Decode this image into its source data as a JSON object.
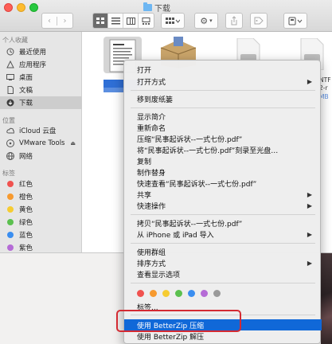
{
  "window": {
    "title": "下载"
  },
  "toolbar": {
    "view_modes": [
      "icon-view",
      "list-view",
      "column-view",
      "gallery-view"
    ],
    "arrange_icon": "grid-arrange-icon",
    "action_icon": "gear-icon",
    "share_icon": "share-icon",
    "tag_icon": "tag-icon",
    "dropbox_icon": "dropbox-icon"
  },
  "sidebar": {
    "favorites_header": "个人收藏",
    "favorites": [
      {
        "label": "最近使用",
        "icon": "clock-icon"
      },
      {
        "label": "应用程序",
        "icon": "apps-icon"
      },
      {
        "label": "桌面",
        "icon": "desktop-icon"
      },
      {
        "label": "文稿",
        "icon": "document-icon"
      },
      {
        "label": "下载",
        "icon": "download-icon",
        "selected": true
      }
    ],
    "locations_header": "位置",
    "locations": [
      {
        "label": "iCloud 云盘",
        "icon": "cloud-icon"
      },
      {
        "label": "VMware Tools",
        "icon": "disk-icon"
      },
      {
        "label": "网络",
        "icon": "globe-icon"
      }
    ],
    "tags_header": "标签",
    "tags": [
      {
        "label": "红色",
        "color": "#f0524f"
      },
      {
        "label": "橙色",
        "color": "#f79a2f"
      },
      {
        "label": "黄色",
        "color": "#f6cc32"
      },
      {
        "label": "绿色",
        "color": "#5bc04f"
      },
      {
        "label": "蓝色",
        "color": "#3b8ef0"
      },
      {
        "label": "紫色",
        "color": "#b56bd6"
      }
    ]
  },
  "files": {
    "partial_label_1": "NTF",
    "partial_label_2": "2-r",
    "partial_size": "MB"
  },
  "menu": {
    "items": [
      {
        "label": "打开"
      },
      {
        "label": "打开方式",
        "submenu": true
      },
      {
        "label": "移到废纸篓"
      },
      {
        "label": "显示简介"
      },
      {
        "label": "重新命名"
      },
      {
        "label": "压缩“民事起诉状--一式七份.pdf”"
      },
      {
        "label": "将“民事起诉状--一式七份.pdf”刻录至光盘…"
      },
      {
        "label": "复制"
      },
      {
        "label": "制作替身"
      },
      {
        "label": "快速查看“民事起诉状--一式七份.pdf”"
      },
      {
        "label": "共享",
        "submenu": true
      },
      {
        "label": "快速操作",
        "submenu": true
      },
      {
        "label": "拷贝“民事起诉状--一式七份.pdf”"
      },
      {
        "label": "从 iPhone 或 iPad 导入",
        "submenu": true
      },
      {
        "label": "使用群组"
      },
      {
        "label": "排序方式",
        "submenu": true
      },
      {
        "label": "查看显示选项"
      },
      {
        "label": "标签..."
      },
      {
        "label": "使用 BetterZip 压缩",
        "highlighted": true
      },
      {
        "label": "使用 BetterZip 解压"
      }
    ],
    "tag_colors": [
      "#f0524f",
      "#f79a2f",
      "#f6cc32",
      "#5bc04f",
      "#3b8ef0",
      "#b56bd6",
      "#9a9a9a"
    ]
  },
  "colors": {
    "highlight": "#1068d8",
    "annotation_box": "#d42a32"
  }
}
